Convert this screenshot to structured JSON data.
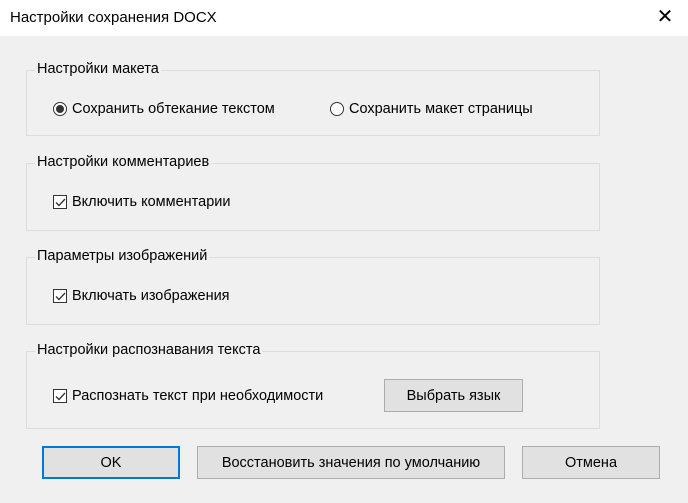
{
  "window": {
    "title": "Настройки сохранения DOCX",
    "close": "✕"
  },
  "layout_group": {
    "title": "Настройки макета",
    "options": [
      {
        "label": "Сохранить обтекание текстом",
        "selected": true
      },
      {
        "label": "Сохранить макет страницы",
        "selected": false
      }
    ]
  },
  "comments_group": {
    "title": "Настройки комментариев",
    "checkbox": {
      "label": "Включить комментарии",
      "checked": true
    }
  },
  "images_group": {
    "title": "Параметры изображений",
    "checkbox": {
      "label": "Включать изображения",
      "checked": true
    }
  },
  "ocr_group": {
    "title": "Настройки распознавания текста",
    "checkbox": {
      "label": "Распознать текст при необходимости",
      "checked": true
    },
    "language_button": "Выбрать язык"
  },
  "buttons": {
    "ok": "OK",
    "restore": "Восстановить значения по умолчанию",
    "cancel": "Отмена"
  }
}
